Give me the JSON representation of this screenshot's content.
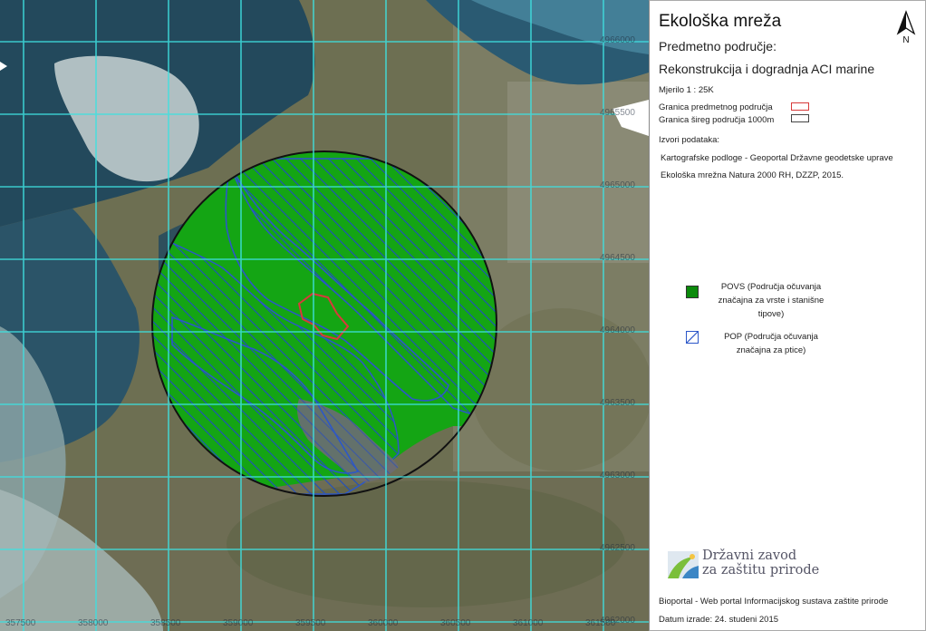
{
  "map": {
    "x_ticks": [
      "357500",
      "358000",
      "358500",
      "359000",
      "359500",
      "360000",
      "360500",
      "361000",
      "361500"
    ],
    "y_ticks": [
      "4966000",
      "4965500",
      "4965000",
      "4964500",
      "4964000",
      "4963500",
      "4963000",
      "4962500",
      "4962000"
    ]
  },
  "panel": {
    "title": "Ekološka mreža",
    "subject_label": "Predmetno područje:",
    "subject_name": "Rekonstrukcija i dogradnja ACI marine",
    "scale": "Mjerilo 1 : 25K",
    "boundary_subject": "Granica predmetnog područja",
    "boundary_wider": "Granica šireg područja 1000m",
    "sources_label": "Izvori podataka:",
    "source_1": "Kartografske podloge - Geoportal Državne geodetske uprave",
    "source_2": "Ekološka mrežna Natura 2000 RH, DZZP, 2015.",
    "north_label": "N",
    "legend": [
      {
        "label": "POVS (Područja očuvanja značajna za vrste i stanišne tipove)",
        "color": "#0b8a0b",
        "pattern": "solid"
      },
      {
        "label": "POP (Područja očuvanja značajna za ptice)",
        "color": "#2f5fd0",
        "pattern": "hatch"
      }
    ],
    "logo_line1": "Državni zavod",
    "logo_line2": "za zaštitu prirode",
    "footer_portal": "Bioportal - Web portal Informacijskog sustava zaštite prirode",
    "footer_date": "Datum izrade: 24. studeni 2015"
  },
  "colors": {
    "povs": "#14a514",
    "pop_hatch": "#2c57c9",
    "subject_boundary": "#d83a3a",
    "wider_boundary": "#444444",
    "grid": "#3fe0e0"
  }
}
